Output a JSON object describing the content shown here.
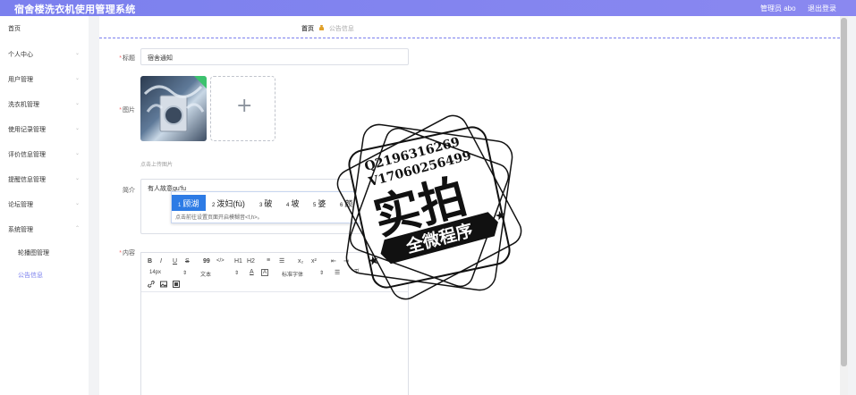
{
  "app": {
    "title": "宿舍楼洗衣机使用管理系统",
    "user_label": "管理员 abo",
    "logout_label": "退出登录"
  },
  "sidebar": {
    "items": [
      {
        "label": "首页",
        "has_caret": false
      },
      {
        "label": "个人中心",
        "has_caret": true
      },
      {
        "label": "用户管理",
        "has_caret": true
      },
      {
        "label": "洗衣机管理",
        "has_caret": true
      },
      {
        "label": "使用记录管理",
        "has_caret": true
      },
      {
        "label": "评价信息管理",
        "has_caret": true
      },
      {
        "label": "提醒信息管理",
        "has_caret": true
      },
      {
        "label": "论坛管理",
        "has_caret": true
      },
      {
        "label": "系统管理",
        "has_caret": true
      }
    ],
    "subitems": [
      {
        "label": "轮播图管理"
      },
      {
        "label": "公告信息",
        "active": true
      }
    ]
  },
  "breadcrumb": {
    "home": "首页",
    "current": "公告信息"
  },
  "form": {
    "title_label": "标题",
    "title_value": "宿舍通知",
    "image_label": "图片",
    "upload_hint": "点击上传图片",
    "intro_label": "简介",
    "intro_value": "有人故意gu'fu",
    "content_label": "内容"
  },
  "ime": {
    "candidates": [
      {
        "num": "1",
        "text": "顾湖"
      },
      {
        "num": "2",
        "text": "泼妇(fù)"
      },
      {
        "num": "3",
        "text": "破"
      },
      {
        "num": "4",
        "text": "坡"
      },
      {
        "num": "5",
        "text": "婆"
      },
      {
        "num": "6",
        "text": "颇"
      },
      {
        "num": "7",
        "text": "魄"
      }
    ],
    "tip": "点击前往设置页面开启模糊音<f,h>。",
    "switch_label": "切换"
  },
  "editor": {
    "toolbar_row1": [
      "B",
      "I",
      "U",
      "S",
      "99",
      "</>",
      "H1",
      "H2",
      "≡",
      "☰",
      "x₂",
      "x²",
      "⇤",
      "⇥"
    ],
    "font_size": "14px",
    "paragraph": "文本",
    "font_family": "标准字体"
  },
  "watermark": {
    "line1": "Q2196316269",
    "line2": "V17060256499",
    "big": "实拍",
    "banner": "全微程序"
  },
  "colors": {
    "accent": "#7b80ee",
    "ime_select": "#2d7be5",
    "required": "#f56c6c"
  }
}
